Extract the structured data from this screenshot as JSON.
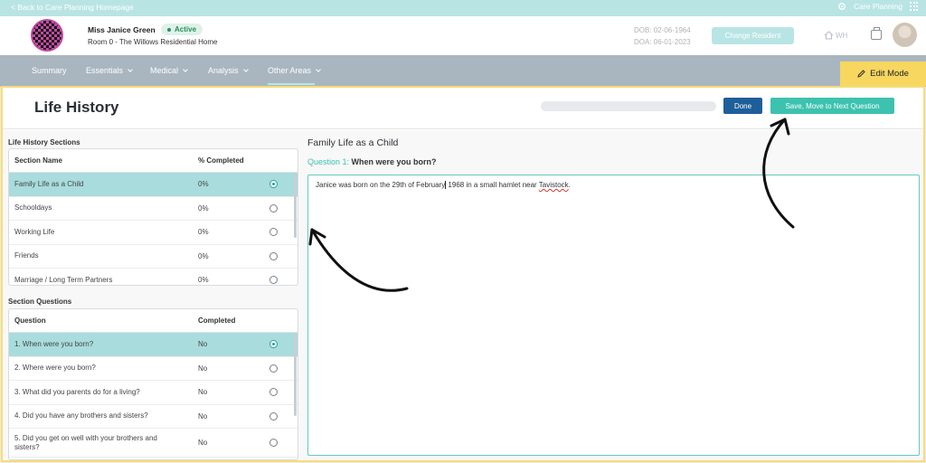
{
  "topbar": {
    "back_link": "< Back to Care Planning Homepage",
    "module": "Care Planning"
  },
  "resident": {
    "name": "Miss Janice Green",
    "status": "Active",
    "room": "Room 0 - The Willows Residential Home",
    "dob": "DOB: 02-06-1964",
    "doa": "DOA: 06-01-2023",
    "change_label": "Change Resident",
    "home_label": "WH"
  },
  "nav": {
    "items": [
      "Summary",
      "Essentials",
      "Medical",
      "Analysis",
      "Other Areas"
    ],
    "active": "Other Areas",
    "edit_mode": "Edit Mode"
  },
  "page": {
    "title": "Life History",
    "done": "Done",
    "save_next": "Save, Move to Next Question"
  },
  "sections": {
    "label": "Life History Sections",
    "col_name": "Section Name",
    "col_completed": "% Completed",
    "rows": [
      {
        "name": "Family Life as a Child",
        "pct": "0%",
        "selected": true
      },
      {
        "name": "Schooldays",
        "pct": "0%",
        "selected": false
      },
      {
        "name": "Working Life",
        "pct": "0%",
        "selected": false
      },
      {
        "name": "Friends",
        "pct": "0%",
        "selected": false
      },
      {
        "name": "Marriage / Long Term Partners",
        "pct": "0%",
        "selected": false
      }
    ]
  },
  "questions": {
    "label": "Section Questions",
    "col_question": "Question",
    "col_completed": "Completed",
    "rows": [
      {
        "text": "1. When were you born?",
        "done": "No",
        "selected": true
      },
      {
        "text": "2. Where were you born?",
        "done": "No",
        "selected": false
      },
      {
        "text": "3. What did you parents do for a living?",
        "done": "No",
        "selected": false
      },
      {
        "text": "4. Did you have any brothers and sisters?",
        "done": "No",
        "selected": false
      },
      {
        "text": "5. Did you get on well with your brothers and sisters?",
        "done": "No",
        "selected": false
      }
    ]
  },
  "editor": {
    "section_title": "Family Life as a Child",
    "question_num": "Question 1:",
    "question_text": "When were you born?",
    "answer_a": "Janice was born on the 29th of February",
    "answer_b": " 1968 in a small hamlet near ",
    "answer_c": "Tavistock",
    "answer_d": "."
  },
  "colors": {
    "accent": "#3cc2ae",
    "primary": "#1f5f99",
    "highlight": "#f5dc7c",
    "nav": "#a9b6c0"
  }
}
